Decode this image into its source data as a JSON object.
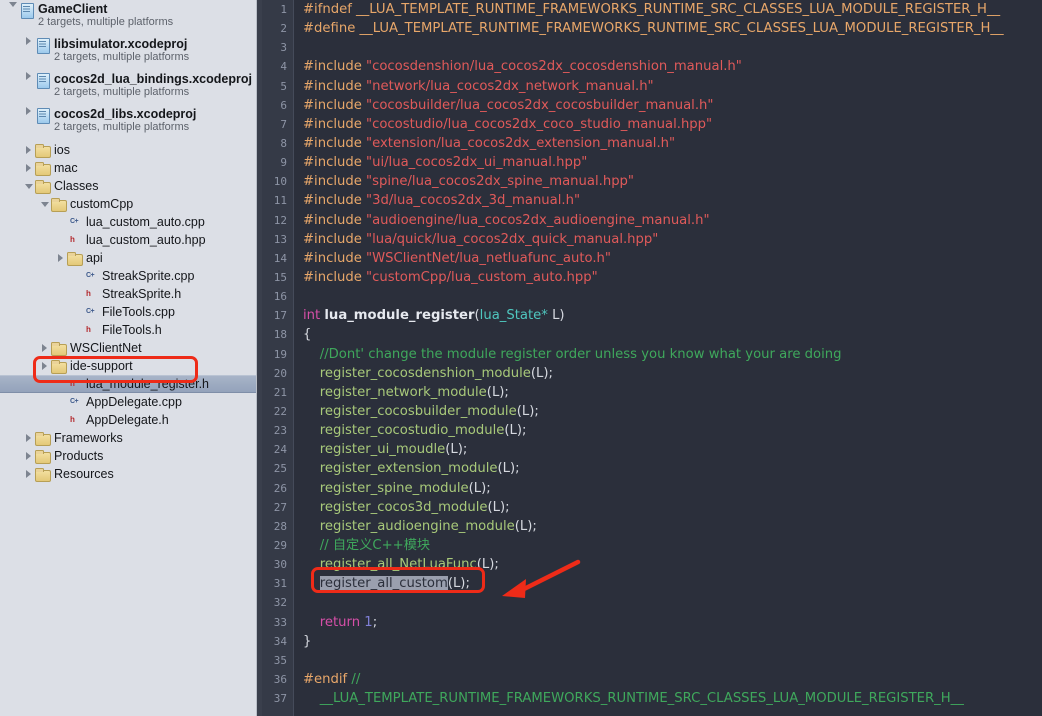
{
  "sidebar": {
    "items": [
      {
        "indent": 0,
        "twisty": "open",
        "icon": "proj",
        "label": "GameClient",
        "bold": true,
        "sub": "2 targets, multiple platforms",
        "selected": false
      },
      {
        "indent": 1,
        "twisty": "closed",
        "icon": "proj",
        "label": "libsimulator.xcodeproj",
        "bold": true,
        "sub": "2 targets, multiple platforms",
        "selected": false
      },
      {
        "indent": 1,
        "twisty": "closed",
        "icon": "proj",
        "label": "cocos2d_lua_bindings.xcodeproj",
        "bold": true,
        "sub": "2 targets, multiple platforms",
        "selected": false
      },
      {
        "indent": 1,
        "twisty": "closed",
        "icon": "proj",
        "label": "cocos2d_libs.xcodeproj",
        "bold": true,
        "sub": "2 targets, multiple platforms",
        "selected": false
      },
      {
        "indent": 1,
        "twisty": "closed",
        "icon": "folder",
        "label": "ios",
        "bold": false,
        "sub": "",
        "selected": false
      },
      {
        "indent": 1,
        "twisty": "closed",
        "icon": "folder",
        "label": "mac",
        "bold": false,
        "sub": "",
        "selected": false
      },
      {
        "indent": 1,
        "twisty": "open",
        "icon": "folder",
        "label": "Classes",
        "bold": false,
        "sub": "",
        "selected": false
      },
      {
        "indent": 2,
        "twisty": "open",
        "icon": "folder",
        "label": "customCpp",
        "bold": false,
        "sub": "",
        "selected": false
      },
      {
        "indent": 3,
        "twisty": "none",
        "icon": "cpp",
        "label": "lua_custom_auto.cpp",
        "bold": false,
        "sub": "",
        "selected": false
      },
      {
        "indent": 3,
        "twisty": "none",
        "icon": "h",
        "label": "lua_custom_auto.hpp",
        "bold": false,
        "sub": "",
        "selected": false
      },
      {
        "indent": 3,
        "twisty": "closed",
        "icon": "folder",
        "label": "api",
        "bold": false,
        "sub": "",
        "selected": false
      },
      {
        "indent": 4,
        "twisty": "none",
        "icon": "cpp",
        "label": "StreakSprite.cpp",
        "bold": false,
        "sub": "",
        "selected": false
      },
      {
        "indent": 4,
        "twisty": "none",
        "icon": "h",
        "label": "StreakSprite.h",
        "bold": false,
        "sub": "",
        "selected": false
      },
      {
        "indent": 4,
        "twisty": "none",
        "icon": "cpp",
        "label": "FileTools.cpp",
        "bold": false,
        "sub": "",
        "selected": false
      },
      {
        "indent": 4,
        "twisty": "none",
        "icon": "h",
        "label": "FileTools.h",
        "bold": false,
        "sub": "",
        "selected": false
      },
      {
        "indent": 2,
        "twisty": "closed",
        "icon": "folder",
        "label": "WSClientNet",
        "bold": false,
        "sub": "",
        "selected": false
      },
      {
        "indent": 2,
        "twisty": "closed",
        "icon": "folder",
        "label": "ide-support",
        "bold": false,
        "sub": "",
        "selected": false
      },
      {
        "indent": 3,
        "twisty": "none",
        "icon": "h",
        "label": "lua_module_register.h",
        "bold": false,
        "sub": "",
        "selected": true
      },
      {
        "indent": 3,
        "twisty": "none",
        "icon": "cpp",
        "label": "AppDelegate.cpp",
        "bold": false,
        "sub": "",
        "selected": false
      },
      {
        "indent": 3,
        "twisty": "none",
        "icon": "h",
        "label": "AppDelegate.h",
        "bold": false,
        "sub": "",
        "selected": false
      },
      {
        "indent": 1,
        "twisty": "closed",
        "icon": "folder",
        "label": "Frameworks",
        "bold": false,
        "sub": "",
        "selected": false
      },
      {
        "indent": 1,
        "twisty": "closed",
        "icon": "folder",
        "label": "Products",
        "bold": false,
        "sub": "",
        "selected": false
      },
      {
        "indent": 1,
        "twisty": "closed",
        "icon": "folder",
        "label": "Resources",
        "bold": false,
        "sub": "",
        "selected": false
      }
    ],
    "icon_badges": {
      "h": "h",
      "cpp": "C+"
    }
  },
  "editor": {
    "first_line": 1,
    "last_line": 37,
    "lines": [
      {
        "n": 1,
        "tokens": [
          {
            "t": "pre",
            "v": "#ifndef "
          },
          {
            "t": "mac",
            "v": "__LUA_TEMPLATE_RUNTIME_FRAMEWORKS_RUNTIME_SRC_CLASSES_LUA_MODULE_REGISTER_H__"
          }
        ]
      },
      {
        "n": 2,
        "tokens": [
          {
            "t": "pre",
            "v": "#define "
          },
          {
            "t": "mac",
            "v": "__LUA_TEMPLATE_RUNTIME_FRAMEWORKS_RUNTIME_SRC_CLASSES_LUA_MODULE_REGISTER_H__"
          }
        ]
      },
      {
        "n": 3,
        "tokens": []
      },
      {
        "n": 4,
        "tokens": [
          {
            "t": "pre",
            "v": "#include "
          },
          {
            "t": "str",
            "v": "\"cocosdenshion/lua_cocos2dx_cocosdenshion_manual.h\""
          }
        ]
      },
      {
        "n": 5,
        "tokens": [
          {
            "t": "pre",
            "v": "#include "
          },
          {
            "t": "str",
            "v": "\"network/lua_cocos2dx_network_manual.h\""
          }
        ]
      },
      {
        "n": 6,
        "tokens": [
          {
            "t": "pre",
            "v": "#include "
          },
          {
            "t": "str",
            "v": "\"cocosbuilder/lua_cocos2dx_cocosbuilder_manual.h\""
          }
        ]
      },
      {
        "n": 7,
        "tokens": [
          {
            "t": "pre",
            "v": "#include "
          },
          {
            "t": "str",
            "v": "\"cocostudio/lua_cocos2dx_coco_studio_manual.hpp\""
          }
        ]
      },
      {
        "n": 8,
        "tokens": [
          {
            "t": "pre",
            "v": "#include "
          },
          {
            "t": "str",
            "v": "\"extension/lua_cocos2dx_extension_manual.h\""
          }
        ]
      },
      {
        "n": 9,
        "tokens": [
          {
            "t": "pre",
            "v": "#include "
          },
          {
            "t": "str",
            "v": "\"ui/lua_cocos2dx_ui_manual.hpp\""
          }
        ]
      },
      {
        "n": 10,
        "tokens": [
          {
            "t": "pre",
            "v": "#include "
          },
          {
            "t": "str",
            "v": "\"spine/lua_cocos2dx_spine_manual.hpp\""
          }
        ]
      },
      {
        "n": 11,
        "tokens": [
          {
            "t": "pre",
            "v": "#include "
          },
          {
            "t": "str",
            "v": "\"3d/lua_cocos2dx_3d_manual.h\""
          }
        ]
      },
      {
        "n": 12,
        "tokens": [
          {
            "t": "pre",
            "v": "#include "
          },
          {
            "t": "str",
            "v": "\"audioengine/lua_cocos2dx_audioengine_manual.h\""
          }
        ]
      },
      {
        "n": 13,
        "tokens": [
          {
            "t": "pre",
            "v": "#include "
          },
          {
            "t": "str",
            "v": "\"lua/quick/lua_cocos2dx_quick_manual.hpp\""
          }
        ]
      },
      {
        "n": 14,
        "tokens": [
          {
            "t": "pre",
            "v": "#include "
          },
          {
            "t": "str",
            "v": "\"WSClientNet/lua_netluafunc_auto.h\""
          }
        ]
      },
      {
        "n": 15,
        "tokens": [
          {
            "t": "pre",
            "v": "#include "
          },
          {
            "t": "str",
            "v": "\"customCpp/lua_custom_auto.hpp\""
          }
        ]
      },
      {
        "n": 16,
        "tokens": []
      },
      {
        "n": 17,
        "tokens": [
          {
            "t": "kw",
            "v": "int"
          },
          {
            "t": "pl",
            "v": " "
          },
          {
            "t": "fnd",
            "v": "lua_module_register"
          },
          {
            "t": "pl",
            "v": "("
          },
          {
            "t": "type",
            "v": "lua_State*"
          },
          {
            "t": "pl",
            "v": " L)"
          }
        ]
      },
      {
        "n": 18,
        "tokens": [
          {
            "t": "pl",
            "v": "{"
          }
        ]
      },
      {
        "n": 19,
        "tokens": [
          {
            "t": "cmt",
            "v": "    //Dont' change the module register order unless you know what your are doing"
          }
        ]
      },
      {
        "n": 20,
        "tokens": [
          {
            "t": "fn",
            "v": "    register_cocosdenshion_module"
          },
          {
            "t": "pl",
            "v": "(L);"
          }
        ]
      },
      {
        "n": 21,
        "tokens": [
          {
            "t": "fn",
            "v": "    register_network_module"
          },
          {
            "t": "pl",
            "v": "(L);"
          }
        ]
      },
      {
        "n": 22,
        "tokens": [
          {
            "t": "fn",
            "v": "    register_cocosbuilder_module"
          },
          {
            "t": "pl",
            "v": "(L);"
          }
        ]
      },
      {
        "n": 23,
        "tokens": [
          {
            "t": "fn",
            "v": "    register_cocostudio_module"
          },
          {
            "t": "pl",
            "v": "(L);"
          }
        ]
      },
      {
        "n": 24,
        "tokens": [
          {
            "t": "fn",
            "v": "    register_ui_moudle"
          },
          {
            "t": "pl",
            "v": "(L);"
          }
        ]
      },
      {
        "n": 25,
        "tokens": [
          {
            "t": "fn",
            "v": "    register_extension_module"
          },
          {
            "t": "pl",
            "v": "(L);"
          }
        ]
      },
      {
        "n": 26,
        "tokens": [
          {
            "t": "fn",
            "v": "    register_spine_module"
          },
          {
            "t": "pl",
            "v": "(L);"
          }
        ]
      },
      {
        "n": 27,
        "tokens": [
          {
            "t": "fn",
            "v": "    register_cocos3d_module"
          },
          {
            "t": "pl",
            "v": "(L);"
          }
        ]
      },
      {
        "n": 28,
        "tokens": [
          {
            "t": "fn",
            "v": "    register_audioengine_module"
          },
          {
            "t": "pl",
            "v": "(L);"
          }
        ]
      },
      {
        "n": 29,
        "tokens": [
          {
            "t": "cmt",
            "v": "    // 自定义C++模块"
          }
        ]
      },
      {
        "n": 30,
        "tokens": [
          {
            "t": "fn",
            "v": "    register_all_NetLuaFunc"
          },
          {
            "t": "pl",
            "v": "(L);"
          }
        ]
      },
      {
        "n": 31,
        "tokens": [
          {
            "t": "pl",
            "v": "    "
          },
          {
            "t": "selfn",
            "v": "register_all_custom"
          },
          {
            "t": "pl",
            "v": "(L);"
          }
        ]
      },
      {
        "n": 32,
        "tokens": []
      },
      {
        "n": 33,
        "tokens": [
          {
            "t": "kw",
            "v": "    return"
          },
          {
            "t": "pl",
            "v": " "
          },
          {
            "t": "num",
            "v": "1"
          },
          {
            "t": "pl",
            "v": ";"
          }
        ]
      },
      {
        "n": 34,
        "tokens": [
          {
            "t": "pl",
            "v": "}"
          }
        ]
      },
      {
        "n": 35,
        "tokens": []
      },
      {
        "n": 36,
        "tokens": [
          {
            "t": "pre",
            "v": "#endif "
          },
          {
            "t": "cmt",
            "v": "//"
          }
        ]
      },
      {
        "n": 37,
        "tokens": [
          {
            "t": "cmt",
            "v": "    __LUA_TEMPLATE_RUNTIME_FRAMEWORKS_RUNTIME_SRC_CLASSES_LUA_MODULE_REGISTER_H__"
          }
        ]
      }
    ]
  },
  "annotations": {
    "color": "#ee2b18",
    "sidebar_box": {
      "label": "highlight around lua_module_register.h"
    },
    "code_box": {
      "label": "highlight around register_all_custom(L);"
    },
    "arrow": {
      "label": "arrow pointing to register_all_custom call"
    }
  },
  "colors": {
    "sidebar_bg": "#dcdfe6",
    "selection_bg": "#9dabc1",
    "editor_bg": "#2b2f3b",
    "gutter_bg": "#353a47",
    "preprocessor": "#e8a76a",
    "string": "#e05a5a",
    "comment": "#3fa85c",
    "keyword": "#d64fa8",
    "type": "#4fc7bf",
    "function": "#a8c97a",
    "number": "#7f7fd6",
    "annotation": "#ee2b18"
  }
}
